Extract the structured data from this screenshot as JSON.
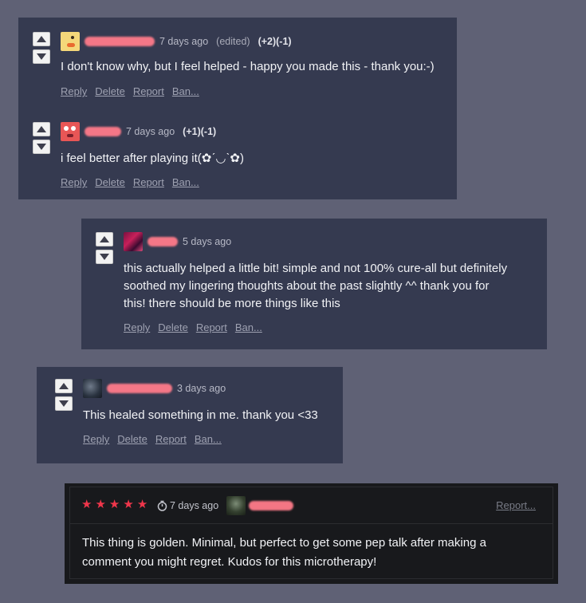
{
  "comments": [
    {
      "age": "7 days ago",
      "edited": "(edited)",
      "score": "(+2)(-1)",
      "text": "I don't know why, but I feel helped - happy you made this - thank you:-)",
      "actions": [
        "Reply",
        "Delete",
        "Report",
        "Ban..."
      ]
    },
    {
      "age": "7 days ago",
      "score": "(+1)(-1)",
      "text": "i feel better after playing it(✿ˊ◡ˋ✿)",
      "actions": [
        "Reply",
        "Delete",
        "Report",
        "Ban..."
      ]
    },
    {
      "age": "5 days ago",
      "text_lines": [
        "this actually helped a little bit! simple and not 100% cure-all but definitely",
        "soothed my lingering thoughts about the past slightly ^^ thank you for",
        "this! there should be more things like this"
      ],
      "actions": [
        "Reply",
        "Delete",
        "Report",
        "Ban..."
      ]
    },
    {
      "age": "3 days ago",
      "text": "This healed something in me. thank you <33",
      "actions": [
        "Reply",
        "Delete",
        "Report",
        "Ban..."
      ]
    }
  ],
  "review": {
    "rating": 5,
    "age": "7 days ago",
    "report": "Report...",
    "text_lines": [
      "This thing is golden.  Minimal, but perfect to get some pep talk after making a",
      "comment you might regret. Kudos for this microtherapy!"
    ]
  },
  "colors": {
    "page_bg": "#5f6175",
    "card_bg": "#353a50",
    "review_bg": "#18191c",
    "star": "#f0364b",
    "redacted_name": "#ff7b8a"
  }
}
